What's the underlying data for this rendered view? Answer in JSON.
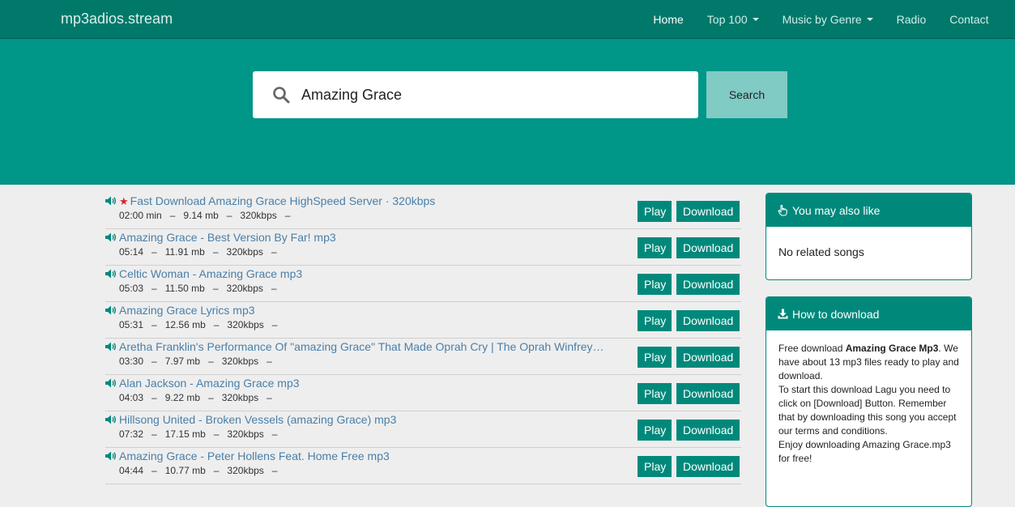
{
  "nav": {
    "brand": "mp3adios.stream",
    "items": [
      {
        "label": "Home",
        "active": true,
        "dropdown": false
      },
      {
        "label": "Top 100",
        "active": false,
        "dropdown": true
      },
      {
        "label": "Music by Genre",
        "active": false,
        "dropdown": true
      },
      {
        "label": "Radio",
        "active": false,
        "dropdown": false
      },
      {
        "label": "Contact",
        "active": false,
        "dropdown": false
      }
    ]
  },
  "search": {
    "value": "Amazing Grace",
    "button": "Search"
  },
  "results": [
    {
      "featured": true,
      "title": "Fast Download Amazing Grace HighSpeed Server · 320kbps",
      "meta": "02:00 min   –   9.14 mb   –   320kbps   –"
    },
    {
      "featured": false,
      "title": "Amazing Grace - Best Version By Far! mp3",
      "meta": "05:14   –   11.91 mb   –   320kbps   –"
    },
    {
      "featured": false,
      "title": "Celtic Woman - Amazing Grace mp3",
      "meta": "05:03   –   11.50 mb   –   320kbps   –"
    },
    {
      "featured": false,
      "title": "Amazing Grace Lyrics mp3",
      "meta": "05:31   –   12.56 mb   –   320kbps   –"
    },
    {
      "featured": false,
      "title": "Aretha Franklin's Performance Of \"amazing Grace\" That Made Oprah Cry | The Oprah Winfrey…",
      "meta": "03:30   –   7.97 mb   –   320kbps   –"
    },
    {
      "featured": false,
      "title": "Alan Jackson - Amazing Grace mp3",
      "meta": "04:03   –   9.22 mb   –   320kbps   –"
    },
    {
      "featured": false,
      "title": "Hillsong United - Broken Vessels (amazing Grace) mp3",
      "meta": "07:32   –   17.15 mb   –   320kbps   –"
    },
    {
      "featured": false,
      "title": "Amazing Grace - Peter Hollens Feat. Home Free mp3",
      "meta": "04:44   –   10.77 mb   –   320kbps   –"
    }
  ],
  "buttons": {
    "play": "Play",
    "download": "Download"
  },
  "sidebar": {
    "related": {
      "title": "You may also like",
      "body": "No related songs"
    },
    "howto": {
      "title": "How to download",
      "p1_pre": "Free download ",
      "p1_bold": "Amazing Grace Mp3",
      "p1_post": ". We have about 13 mp3 files ready to play and download.",
      "p2": "To start this download Lagu you need to click on [Download] Button. Remember that by downloading this song you accept our terms and conditions.",
      "p3": "Enjoy downloading Amazing Grace.mp3 for free!"
    }
  },
  "colors": {
    "header": "#00796b",
    "hero": "#009688",
    "accent": "#00897b",
    "link": "#4a7fa8",
    "star": "#d9232f"
  }
}
